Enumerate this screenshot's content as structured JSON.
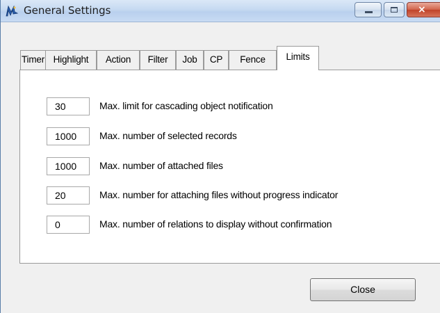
{
  "window": {
    "title": "General Settings",
    "icon": "app-logo-icon",
    "controls": {
      "minimize": "minimize-icon",
      "maximize": "maximize-icon",
      "close": "×"
    }
  },
  "tabs": [
    {
      "label": "Timer"
    },
    {
      "label": "Highlight"
    },
    {
      "label": "Action"
    },
    {
      "label": "Filter"
    },
    {
      "label": "Job"
    },
    {
      "label": "CP"
    },
    {
      "label": "Fence"
    },
    {
      "label": "Limits"
    }
  ],
  "active_tab": "Limits",
  "limits": [
    {
      "value": "30",
      "label": "Max. limit for cascading object notification"
    },
    {
      "value": "1000",
      "label": "Max. number of selected records"
    },
    {
      "value": "1000",
      "label": "Max. number of attached files"
    },
    {
      "value": "20",
      "label": "Max. number for attaching files without progress indicator"
    },
    {
      "value": "0",
      "label": "Max. number of relations to display without confirmation"
    }
  ],
  "footer": {
    "close_label": "Close"
  },
  "colors": {
    "titlebar": "#c5d9f1",
    "close_button": "#c0432a",
    "panel": "#ffffff",
    "window_bg": "#f0f0f0"
  }
}
